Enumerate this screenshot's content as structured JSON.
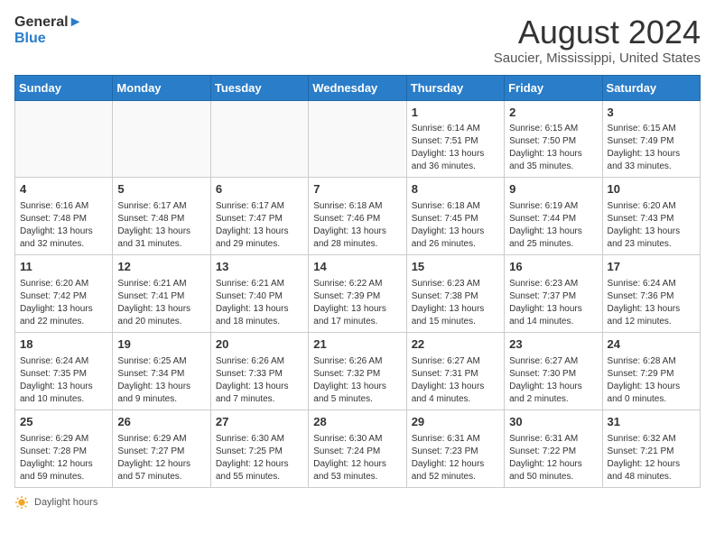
{
  "app": {
    "name_general": "General",
    "name_blue": "Blue"
  },
  "title": {
    "month_year": "August 2024",
    "location": "Saucier, Mississippi, United States"
  },
  "weekdays": [
    "Sunday",
    "Monday",
    "Tuesday",
    "Wednesday",
    "Thursday",
    "Friday",
    "Saturday"
  ],
  "weeks": [
    [
      {
        "day": "",
        "info": ""
      },
      {
        "day": "",
        "info": ""
      },
      {
        "day": "",
        "info": ""
      },
      {
        "day": "",
        "info": ""
      },
      {
        "day": "1",
        "info": "Sunrise: 6:14 AM\nSunset: 7:51 PM\nDaylight: 13 hours\nand 36 minutes."
      },
      {
        "day": "2",
        "info": "Sunrise: 6:15 AM\nSunset: 7:50 PM\nDaylight: 13 hours\nand 35 minutes."
      },
      {
        "day": "3",
        "info": "Sunrise: 6:15 AM\nSunset: 7:49 PM\nDaylight: 13 hours\nand 33 minutes."
      }
    ],
    [
      {
        "day": "4",
        "info": "Sunrise: 6:16 AM\nSunset: 7:48 PM\nDaylight: 13 hours\nand 32 minutes."
      },
      {
        "day": "5",
        "info": "Sunrise: 6:17 AM\nSunset: 7:48 PM\nDaylight: 13 hours\nand 31 minutes."
      },
      {
        "day": "6",
        "info": "Sunrise: 6:17 AM\nSunset: 7:47 PM\nDaylight: 13 hours\nand 29 minutes."
      },
      {
        "day": "7",
        "info": "Sunrise: 6:18 AM\nSunset: 7:46 PM\nDaylight: 13 hours\nand 28 minutes."
      },
      {
        "day": "8",
        "info": "Sunrise: 6:18 AM\nSunset: 7:45 PM\nDaylight: 13 hours\nand 26 minutes."
      },
      {
        "day": "9",
        "info": "Sunrise: 6:19 AM\nSunset: 7:44 PM\nDaylight: 13 hours\nand 25 minutes."
      },
      {
        "day": "10",
        "info": "Sunrise: 6:20 AM\nSunset: 7:43 PM\nDaylight: 13 hours\nand 23 minutes."
      }
    ],
    [
      {
        "day": "11",
        "info": "Sunrise: 6:20 AM\nSunset: 7:42 PM\nDaylight: 13 hours\nand 22 minutes."
      },
      {
        "day": "12",
        "info": "Sunrise: 6:21 AM\nSunset: 7:41 PM\nDaylight: 13 hours\nand 20 minutes."
      },
      {
        "day": "13",
        "info": "Sunrise: 6:21 AM\nSunset: 7:40 PM\nDaylight: 13 hours\nand 18 minutes."
      },
      {
        "day": "14",
        "info": "Sunrise: 6:22 AM\nSunset: 7:39 PM\nDaylight: 13 hours\nand 17 minutes."
      },
      {
        "day": "15",
        "info": "Sunrise: 6:23 AM\nSunset: 7:38 PM\nDaylight: 13 hours\nand 15 minutes."
      },
      {
        "day": "16",
        "info": "Sunrise: 6:23 AM\nSunset: 7:37 PM\nDaylight: 13 hours\nand 14 minutes."
      },
      {
        "day": "17",
        "info": "Sunrise: 6:24 AM\nSunset: 7:36 PM\nDaylight: 13 hours\nand 12 minutes."
      }
    ],
    [
      {
        "day": "18",
        "info": "Sunrise: 6:24 AM\nSunset: 7:35 PM\nDaylight: 13 hours\nand 10 minutes."
      },
      {
        "day": "19",
        "info": "Sunrise: 6:25 AM\nSunset: 7:34 PM\nDaylight: 13 hours\nand 9 minutes."
      },
      {
        "day": "20",
        "info": "Sunrise: 6:26 AM\nSunset: 7:33 PM\nDaylight: 13 hours\nand 7 minutes."
      },
      {
        "day": "21",
        "info": "Sunrise: 6:26 AM\nSunset: 7:32 PM\nDaylight: 13 hours\nand 5 minutes."
      },
      {
        "day": "22",
        "info": "Sunrise: 6:27 AM\nSunset: 7:31 PM\nDaylight: 13 hours\nand 4 minutes."
      },
      {
        "day": "23",
        "info": "Sunrise: 6:27 AM\nSunset: 7:30 PM\nDaylight: 13 hours\nand 2 minutes."
      },
      {
        "day": "24",
        "info": "Sunrise: 6:28 AM\nSunset: 7:29 PM\nDaylight: 13 hours\nand 0 minutes."
      }
    ],
    [
      {
        "day": "25",
        "info": "Sunrise: 6:29 AM\nSunset: 7:28 PM\nDaylight: 12 hours\nand 59 minutes."
      },
      {
        "day": "26",
        "info": "Sunrise: 6:29 AM\nSunset: 7:27 PM\nDaylight: 12 hours\nand 57 minutes."
      },
      {
        "day": "27",
        "info": "Sunrise: 6:30 AM\nSunset: 7:25 PM\nDaylight: 12 hours\nand 55 minutes."
      },
      {
        "day": "28",
        "info": "Sunrise: 6:30 AM\nSunset: 7:24 PM\nDaylight: 12 hours\nand 53 minutes."
      },
      {
        "day": "29",
        "info": "Sunrise: 6:31 AM\nSunset: 7:23 PM\nDaylight: 12 hours\nand 52 minutes."
      },
      {
        "day": "30",
        "info": "Sunrise: 6:31 AM\nSunset: 7:22 PM\nDaylight: 12 hours\nand 50 minutes."
      },
      {
        "day": "31",
        "info": "Sunrise: 6:32 AM\nSunset: 7:21 PM\nDaylight: 12 hours\nand 48 minutes."
      }
    ]
  ],
  "footer": {
    "daylight_label": "Daylight hours"
  }
}
